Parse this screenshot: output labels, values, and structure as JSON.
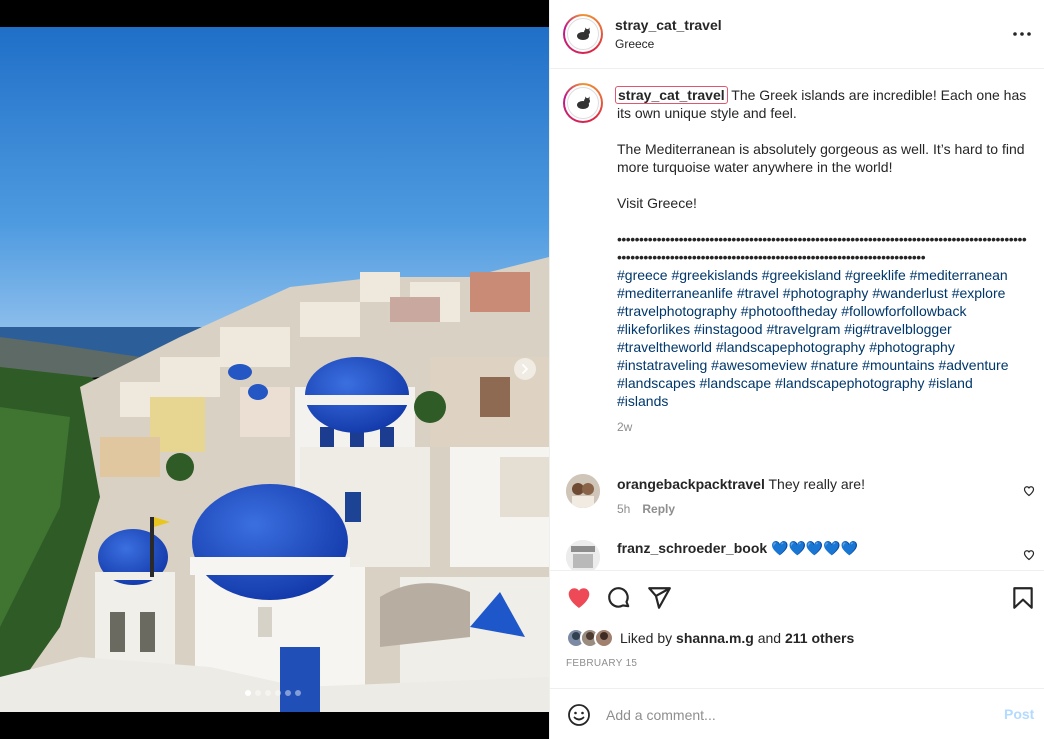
{
  "post": {
    "username": "stray_cat_travel",
    "location": "Greece",
    "caption": {
      "username": "stray_cat_travel",
      "p1": "The Greek islands are incredible! Each one has its own unique style and feel.",
      "p2": "The Mediterranean is absolutely gorgeous as well. It’s hard to find more turquoise water anywhere in the world!",
      "p3": "Visit Greece!",
      "dots": "•••••••••••••••••••••••••••••••••••••••••••••••••••••••••••••••••••••••••••••••••••••••••••••••••••••••••••••••••••••••••••••••••••••••••••••••••••••••••••••••••••",
      "hashtags": [
        "#greece",
        "#greekislands",
        "#greekisland",
        "#greeklife",
        "#mediterranean",
        "#mediterraneanlife",
        "#travel",
        "#photography",
        "#wanderlust",
        "#explore",
        "#travelphotography",
        "#photooftheday",
        "#followforfollowback",
        "#likeforlikes",
        "#instagood",
        "#travelgram",
        "#ig#travelblogger",
        "#traveltheworld",
        "#landscapephotography",
        "#photography",
        "#instatraveling",
        "#awesomeview",
        "#nature",
        "#mountains",
        "#adventure",
        "#landscapes",
        "#landscape",
        "#landscapephotography",
        "#island",
        "#islands"
      ],
      "age": "2w"
    },
    "comments": [
      {
        "username": "orangebackpacktravel",
        "text": "They really are!",
        "age": "5h",
        "reply_label": "Reply"
      },
      {
        "username": "franz_schroeder_book",
        "text": "💙💙💙💙💙"
      }
    ],
    "likes": {
      "prefix": "Liked by",
      "user": "shanna.m.g",
      "and": "and",
      "others": "211 others"
    },
    "date": "FEBRUARY 15",
    "carousel": {
      "slide_count": 6,
      "active_index": 0
    }
  },
  "add_comment": {
    "placeholder": "Add a comment...",
    "post_label": "Post"
  },
  "colors": {
    "like_red": "#ed4956",
    "hashtag_blue": "#00376b",
    "post_disabled": "#b3dbff"
  },
  "icons": {
    "header": "more-horizontal-icon",
    "actions": [
      "heart-filled-icon",
      "comment-icon",
      "share-icon",
      "bookmark-icon"
    ],
    "composer": "emoji-icon",
    "media": "chevron-right-icon"
  }
}
